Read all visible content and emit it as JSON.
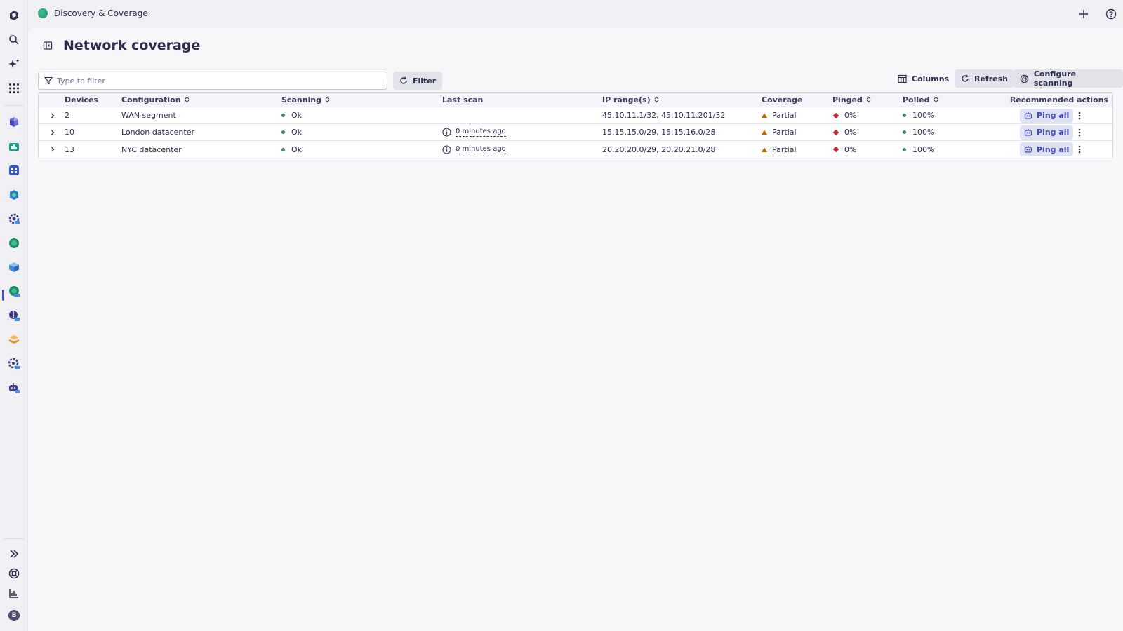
{
  "app": {
    "name": "Discovery & Coverage"
  },
  "page": {
    "title": "Network coverage"
  },
  "toolbar": {
    "filter_placeholder": "Type to filter",
    "filter_button": "Filter",
    "columns_button": "Columns",
    "refresh_button": "Refresh",
    "configure_button": "Configure scanning"
  },
  "table": {
    "headers": {
      "devices": "Devices",
      "configuration": "Configuration",
      "scanning": "Scanning",
      "last_scan": "Last scan",
      "ip_ranges": "IP range(s)",
      "coverage": "Coverage",
      "pinged": "Pinged",
      "polled": "Polled",
      "recommended": "Recommended actions"
    },
    "rows": [
      {
        "devices": "2",
        "configuration": "WAN segment",
        "scanning": "Ok",
        "last_scan": "",
        "ip_ranges": "45.10.11.1/32, 45.10.11.201/32",
        "coverage": "Partial",
        "pinged": "0%",
        "polled": "100%",
        "action": "Ping all"
      },
      {
        "devices": "10",
        "configuration": "London datacenter",
        "scanning": "Ok",
        "last_scan": "0 minutes ago",
        "ip_ranges": "15.15.15.0/29, 15.15.16.0/28",
        "coverage": "Partial",
        "pinged": "0%",
        "polled": "100%",
        "action": "Ping all"
      },
      {
        "devices": "13",
        "configuration": "NYC datacenter",
        "scanning": "Ok",
        "last_scan": "0 minutes ago",
        "ip_ranges": "20.20.20.0/29, 20.20.21.0/28",
        "coverage": "Partial",
        "pinged": "0%",
        "polled": "100%",
        "action": "Ping all"
      }
    ]
  },
  "rail": {
    "user_initial": "B"
  },
  "colors": {
    "ok": "#2f8a5c",
    "partial": "#b46f00",
    "pinged": "#c4213d",
    "accent": "#4547b4"
  }
}
